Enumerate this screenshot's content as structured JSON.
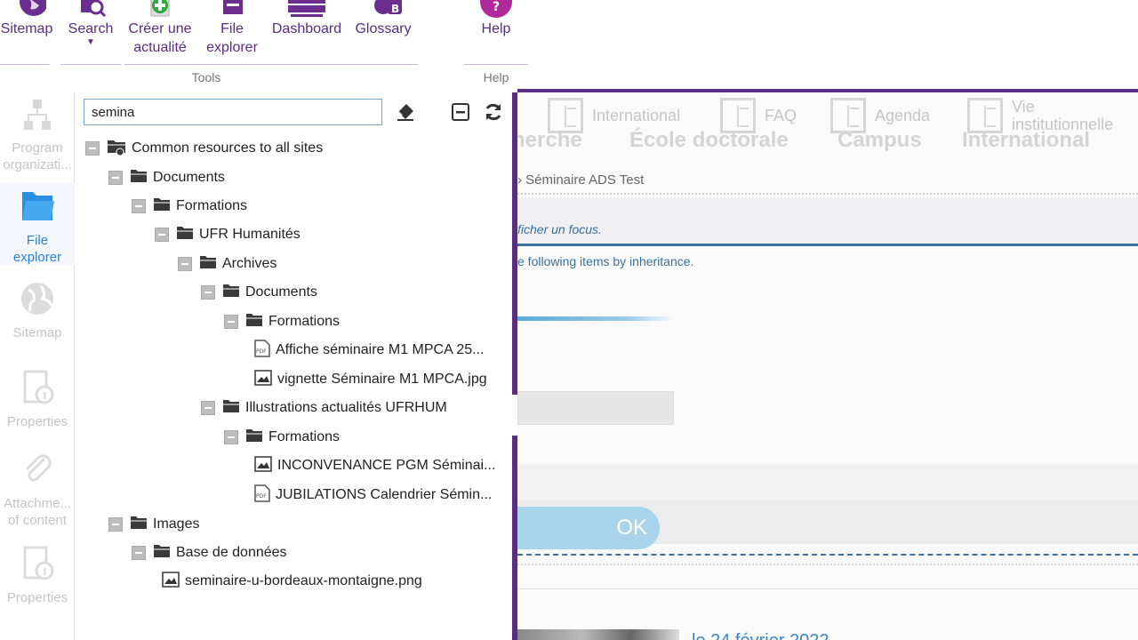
{
  "ribbon": {
    "buttons": [
      {
        "id": "sitemap",
        "label": "Sitemap",
        "icon": "globe-icon"
      },
      {
        "id": "search",
        "label": "Search",
        "icon": "search-icon"
      },
      {
        "id": "create",
        "label": "Créer une actualité",
        "line1": "Créer une",
        "line2": "actualité",
        "icon": "add-document-icon"
      },
      {
        "id": "file-explorer",
        "label": "File explorer",
        "line1": "File",
        "line2": "explorer",
        "icon": "folder-icon"
      },
      {
        "id": "dashboard",
        "label": "Dashboard",
        "icon": "dashboard-icon"
      },
      {
        "id": "glossary",
        "label": "Glossary",
        "icon": "glossary-icon"
      },
      {
        "id": "help",
        "label": "Help",
        "icon": "help-icon"
      }
    ],
    "groups": {
      "tools": "Tools",
      "help": "Help"
    }
  },
  "leftbar": {
    "items": [
      {
        "label_line1": "Program",
        "label_line2": "organizati...",
        "active": false
      },
      {
        "label_line1": "File",
        "label_line2": "explorer",
        "active": true
      },
      {
        "label_line1": "Sitemap",
        "label_line2": "",
        "active": false
      },
      {
        "label_line1": "Properties",
        "label_line2": "",
        "active": false
      },
      {
        "label_line1": "Attachme...",
        "label_line2": "of content",
        "active": false
      },
      {
        "label_line1": "Properties",
        "label_line2": "",
        "active": false
      }
    ]
  },
  "explorer": {
    "search_value": "semina",
    "tree": [
      {
        "label": "Common resources to all sites",
        "type": "root"
      },
      {
        "label": "Documents",
        "type": "folder"
      },
      {
        "label": "Formations",
        "type": "folder"
      },
      {
        "label": "UFR Humanités",
        "type": "folder"
      },
      {
        "label": "Archives",
        "type": "folder"
      },
      {
        "label": "Documents",
        "type": "folder"
      },
      {
        "label": "Formations",
        "type": "folder"
      },
      {
        "label": "Affiche séminaire M1 MPCA 25...",
        "type": "pdf"
      },
      {
        "label": "vignette Séminaire M1 MPCA.jpg",
        "type": "image"
      },
      {
        "label": "Illustrations actualités UFRHUM",
        "type": "folder"
      },
      {
        "label": "Formations",
        "type": "folder"
      },
      {
        "label": "INCONVENANCE PGM Séminai...",
        "type": "image"
      },
      {
        "label": "JUBILATIONS Calendrier Sémin...",
        "type": "pdf"
      },
      {
        "label": "Images",
        "type": "folder"
      },
      {
        "label": "Base de données",
        "type": "folder"
      },
      {
        "label": "seminaire-u-bordeaux-montaigne.png",
        "type": "image"
      }
    ]
  },
  "site": {
    "nav": [
      "International",
      "FAQ",
      "Agenda",
      "Vie institutionnelle"
    ],
    "nav_line1": "Vie",
    "nav_line2": "institutionnelle",
    "ghost_menu": [
      "herche",
      "École doctorale",
      "Campus",
      "International"
    ],
    "breadcrumb": "› Séminaire ADS Test",
    "focus_text": "ficher un focus.",
    "inherit_text": "e following items by inheritance.",
    "ok_label": "OK",
    "date_fragment": "le 24 février 2022"
  }
}
